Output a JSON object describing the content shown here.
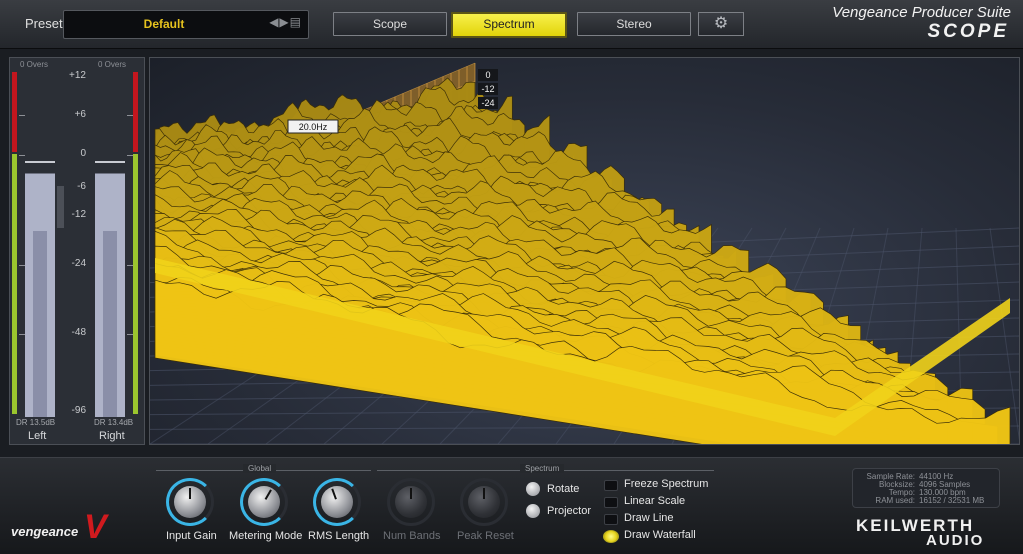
{
  "topbar": {
    "preset_label": "Preset",
    "preset_value": "Default",
    "preset_nav_icons": "◀▶▤",
    "tabs": [
      {
        "label": "Scope"
      },
      {
        "label": "Spectrum"
      },
      {
        "label": "Stereo"
      }
    ],
    "active_tab": "Spectrum",
    "settings_icon": "gear-icon",
    "brand_line1": "Vengeance Producer Suite",
    "brand_line2": "SCOPE"
  },
  "meter": {
    "left_overs": "0 Overs",
    "right_overs": "0 Overs",
    "scale": [
      "+12",
      "+6",
      "0",
      "-6",
      "-12",
      "-24",
      "-48",
      "-96"
    ],
    "left_dr": "DR 13.5dB",
    "right_dr": "DR 13.4dB",
    "left_label": "Left",
    "right_label": "Right"
  },
  "spectrum": {
    "frequency_label": "20.0Hz",
    "db_labels": [
      "0",
      "-12",
      "-24"
    ],
    "accent_color": "#f1d31a"
  },
  "controls": {
    "global_title": "Global",
    "spectrum_title": "Spectrum",
    "knobs": [
      {
        "label": "Input Gain"
      },
      {
        "label": "Metering Mode"
      },
      {
        "label": "RMS Length"
      },
      {
        "label": "Num Bands"
      },
      {
        "label": "Peak Reset"
      }
    ],
    "radios": [
      {
        "label": "Rotate"
      },
      {
        "label": "Projector"
      }
    ],
    "checkboxes": [
      {
        "label": "Freeze Spectrum",
        "checked": false
      },
      {
        "label": "Linear Scale",
        "checked": false
      },
      {
        "label": "Draw Line",
        "checked": false
      },
      {
        "label": "Draw Waterfall",
        "checked": true
      }
    ]
  },
  "info": {
    "rows": [
      {
        "key": "Sample Rate:",
        "value": "44100 Hz"
      },
      {
        "key": "Blocksize:",
        "value": "4096 Samples"
      },
      {
        "key": "Tempo:",
        "value": "130.000 bpm"
      },
      {
        "key": "RAM used:",
        "value": "16152 / 32531 MB"
      }
    ]
  },
  "branding": {
    "vengeance": "vengeance",
    "vengeance_mark": "V",
    "keilwerth_line1": "KEILWERTH",
    "keilwerth_line2": "AUDIO"
  }
}
